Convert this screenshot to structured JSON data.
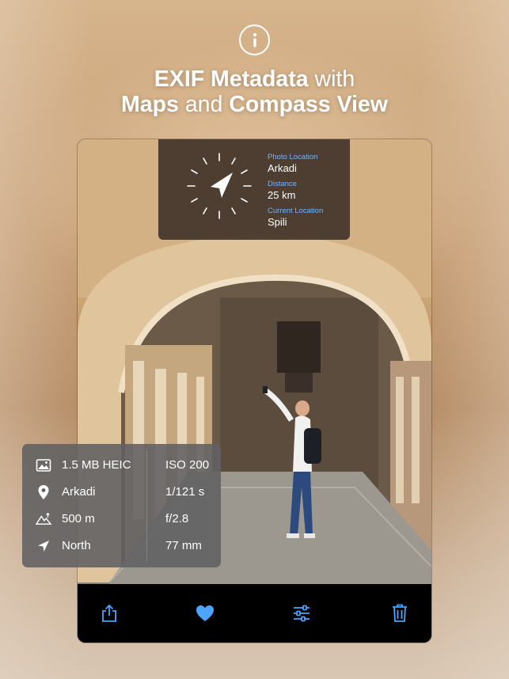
{
  "headline": {
    "line1_bold": "EXIF Metadata",
    "line1_rest": " with",
    "line2_bold1": "Maps",
    "line2_mid": " and ",
    "line2_bold2": "Compass View"
  },
  "compass": {
    "photo_location_label": "Photo Location",
    "photo_location_value": "Arkadi",
    "distance_label": "Distance",
    "distance_value": "25 km",
    "current_location_label": "Current Location",
    "current_location_value": "Spili"
  },
  "exif": {
    "rows": [
      {
        "icon": "photo-icon",
        "label": "1.5 MB HEIC",
        "value": "ISO 200"
      },
      {
        "icon": "location-pin-icon",
        "label": "Arkadi",
        "value": "1/121 s"
      },
      {
        "icon": "altitude-icon",
        "label": "500 m",
        "value": "f/2.8"
      },
      {
        "icon": "heading-arrow-icon",
        "label": "North",
        "value": "77 mm"
      }
    ]
  },
  "toolbar": {
    "buttons": [
      "share-icon",
      "heart-icon",
      "adjust-icon",
      "trash-icon"
    ]
  },
  "colors": {
    "accent": "#4ea3ff",
    "label_blue": "#6fb6ff"
  }
}
